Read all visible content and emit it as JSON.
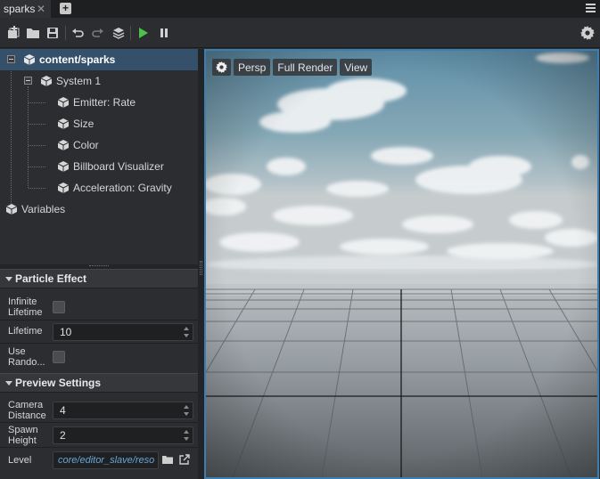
{
  "tabs": [
    {
      "label": "sparks",
      "close_icon": "close-icon"
    }
  ],
  "tabbar": {
    "new_tab_icon": "add-tab-icon",
    "menu_icon": "hamburger-menu-icon"
  },
  "toolbar": {
    "buttons": [
      "add-new-icon",
      "open-folder-icon",
      "save-icon",
      "undo-icon",
      "redo-icon",
      "layers-icon",
      "play-icon",
      "pause-icon"
    ],
    "settings_icon": "gear-icon",
    "play_color": "#4cc24c"
  },
  "tree": {
    "root": "content/sparks",
    "system": "System 1",
    "items": [
      "Emitter: Rate",
      "Size",
      "Color",
      "Billboard Visualizer",
      "Acceleration: Gravity"
    ],
    "variables": "Variables"
  },
  "particle_effect": {
    "title": "Particle Effect",
    "infinite_lifetime_label_1": "Infinite",
    "infinite_lifetime_label_2": "Lifetime",
    "infinite_lifetime_checked": false,
    "lifetime_label": "Lifetime",
    "lifetime_value": "10",
    "use_random_label_1": "Use",
    "use_random_label_2": "Rando...",
    "use_random_checked": false
  },
  "preview_settings": {
    "title": "Preview Settings",
    "camera_distance_label_1": "Camera",
    "camera_distance_label_2": "Distance",
    "camera_distance_value": "4",
    "spawn_height_label_1": "Spawn",
    "spawn_height_label_2": "Height",
    "spawn_height_value": "2",
    "level_label": "Level",
    "level_value": "core/editor_slave/reso",
    "browse_icon": "folder-icon",
    "open_icon": "external-link-icon"
  },
  "viewport": {
    "buttons": [
      "Persp",
      "Full Render",
      "View"
    ],
    "settings_icon": "gear-icon",
    "accent": "#3e7db0"
  }
}
